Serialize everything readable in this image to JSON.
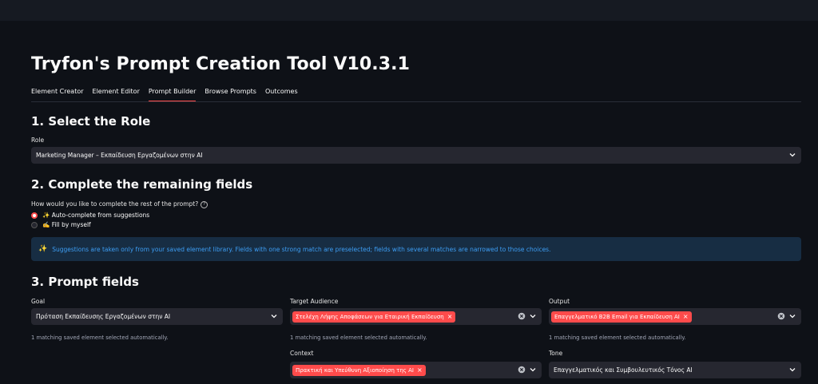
{
  "app": {
    "title": "Tryfon's Prompt Creation Tool V10.3.1"
  },
  "tabs": [
    {
      "label": "Element Creator"
    },
    {
      "label": "Element Editor"
    },
    {
      "label": "Prompt Builder",
      "active": true
    },
    {
      "label": "Browse Prompts"
    },
    {
      "label": "Outcomes"
    }
  ],
  "section1": {
    "heading": "1. Select the Role",
    "role_label": "Role",
    "role_value": "Marketing Manager – Εκπαίδευση Εργαζομένων στην AI"
  },
  "section2": {
    "heading": "2. Complete the remaining fields",
    "question": "How would you like to complete the rest of the prompt?",
    "help": "?",
    "options": [
      {
        "label": "✨ Auto-complete from suggestions",
        "selected": true
      },
      {
        "label": "✍️ Fill by myself",
        "selected": false
      }
    ],
    "info_icon": "✨",
    "info_text": "Suggestions are taken only from your saved element library. Fields with one strong match are preselected; fields with several matches are narrowed to those choices."
  },
  "section3": {
    "heading": "3. Prompt fields",
    "goal": {
      "label": "Goal",
      "value": "Πρόταση Εκπαίδευσης Εργαζομένων στην AI",
      "caption": "1 matching saved element selected automatically."
    },
    "target_audience": {
      "label": "Target Audience",
      "chip": "Στελέχη Λήψης Αποφάσεων για Εταιρική Εκπαίδευση",
      "caption": "1 matching saved element selected automatically."
    },
    "output": {
      "label": "Output",
      "chip": "Επαγγελματικό B2B Email για Εκπαίδευση AI",
      "caption": "1 matching saved element selected automatically."
    },
    "context": {
      "label": "Context",
      "chip": "Πρακτική και Υπεύθυνη Αξιοποίηση της AI"
    },
    "tone": {
      "label": "Tone",
      "value": "Επαγγελματικός και Συμβουλευτικός Τόνος AI"
    }
  },
  "colors": {
    "background": "#0e1117",
    "accent": "#ff4b4b",
    "input_bg": "#262730",
    "info_bg": "#172d43",
    "info_text": "#3d9df3"
  },
  "icons": {
    "chevron": "chevron-down-icon",
    "clear": "clear-icon",
    "chip_remove": "close-icon"
  }
}
